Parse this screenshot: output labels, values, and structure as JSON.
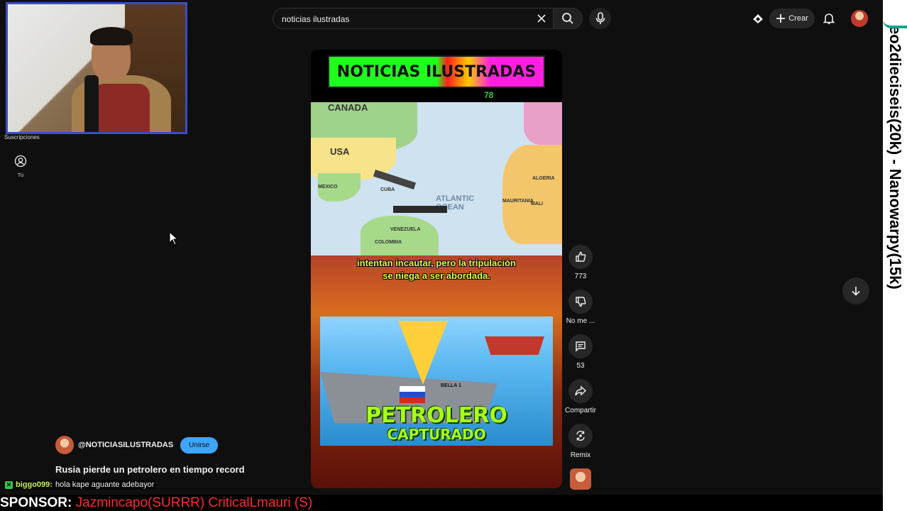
{
  "sidebar": {
    "subscriptions_label": "Suscripciones",
    "you_label": "Tú"
  },
  "search": {
    "value": "noticias ilustradas",
    "icons": [
      "close-icon",
      "search-icon",
      "microphone-icon"
    ]
  },
  "header": {
    "create_label": "Crear",
    "icons": [
      "cast-icon",
      "plus-icon",
      "bell-icon"
    ]
  },
  "short": {
    "banner_text": "NOTICIAS ILUSTRADAS",
    "banner_number": "78",
    "map_labels": {
      "canada": "CANADA",
      "usa": "USA",
      "mexico": "MEXICO",
      "cuba": "CUBA",
      "algeria": "ALGERIA",
      "mali": "MALI",
      "mauritania": "MAURITANIA",
      "venezuela": "VENEZUELA",
      "colombia": "COLOMBIA",
      "ocean": "ATLANTIC OCEAN"
    },
    "subtitle_line1": "intentan incautar, pero la tripulación",
    "subtitle_line2": "se niega a ser abordada.",
    "thumb_title1": "PETROLERO",
    "thumb_title2": "CAPTURADO",
    "thumb_ship_label": "BELLA 1"
  },
  "actions": {
    "like_count": "773",
    "dislike_label": "No me ...",
    "comments_count": "53",
    "share_label": "Compartir",
    "remix_label": "Remix"
  },
  "channel": {
    "handle": "@NOTICIASILUSTRADAS",
    "join_label": "Unirse"
  },
  "video": {
    "title": "Rusia pierde un petrolero en tiempo record"
  },
  "chat": {
    "user": "biggo099:",
    "message": "hola kape aguante adebayor"
  },
  "sponsor": {
    "label": "SPONSOR:",
    "names": "Jazmincapo(SURRR) CriticalLmauri (S)"
  },
  "ticker": {
    "text": "eo2dieciseis(20k) - Nanowarpy(15k)"
  },
  "colors": {
    "background": "#0f0f0f",
    "join_button": "#3ea6ff",
    "sponsor_names": "#ff2a2a",
    "chat_user": "#c9f04a",
    "subtitle": "#e8ff3a"
  }
}
